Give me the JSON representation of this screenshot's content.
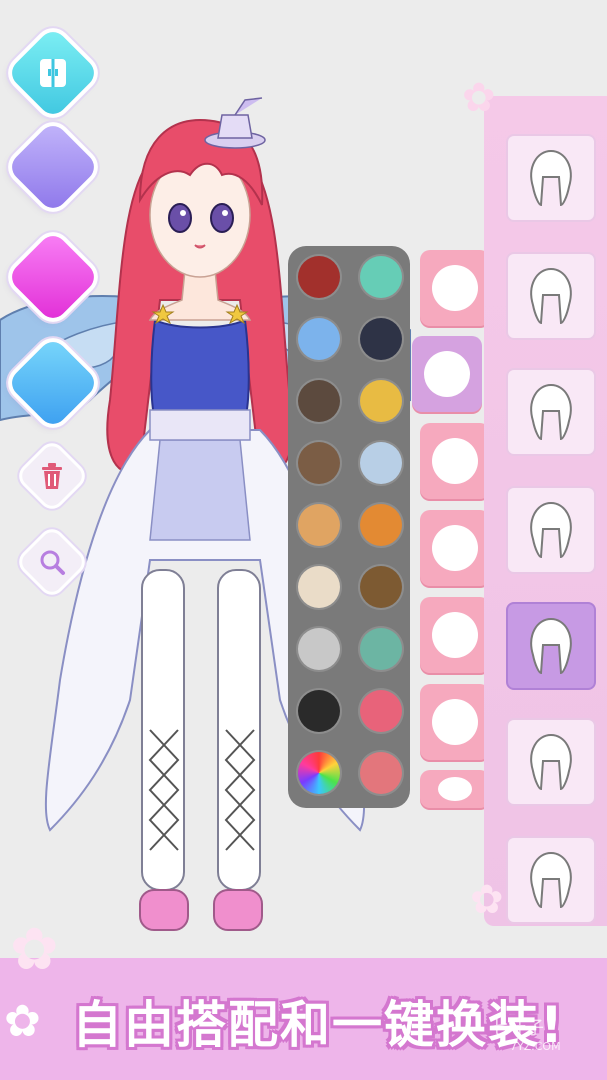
{
  "banner": {
    "title": "自由搭配和一键换装!",
    "watermark": "七叶子",
    "watermark_url": "7YZ.COM"
  },
  "tools": [
    {
      "icon": "wardrobe-icon",
      "color": "#4fd7e4"
    },
    {
      "icon": "background-color-icon",
      "color": "#a38cf0"
    },
    {
      "icon": "skin-color-icon",
      "color": "#f24ae6"
    },
    {
      "icon": "hair-color-icon",
      "color": "#4cb8f5"
    },
    {
      "icon": "trash-icon",
      "color": "#e05a78"
    },
    {
      "icon": "zoom-icon",
      "color": "#b77ee0"
    }
  ],
  "palette": {
    "colors": [
      "#a2302c",
      "#66cdb6",
      "#7cb3ec",
      "#2e3346",
      "#5c4a3e",
      "#e8bb43",
      "#7b5d45",
      "#b8cfe6",
      "#e0a462",
      "#e38a33",
      "#eadcc8",
      "#7d5a32",
      "#c8c8c8",
      "#6cb5a3",
      "#2a2a2a",
      "#e8637a",
      "rainbow",
      "#e3767c"
    ]
  },
  "categories": [
    {
      "icon": "hair-color-split-icon",
      "selected": false
    },
    {
      "icon": "hairstyle-icon",
      "selected": true
    },
    {
      "icon": "back-hair-icon",
      "selected": false
    },
    {
      "icon": "face-icon",
      "selected": false
    },
    {
      "icon": "eyes-closed-face-icon",
      "selected": false
    },
    {
      "icon": "smile-face-icon",
      "selected": false
    },
    {
      "icon": "cat-ears-icon",
      "selected": false
    }
  ],
  "hair_options": [
    {
      "name": "short-messy-hair",
      "selected": false
    },
    {
      "name": "bun-updo-hair",
      "selected": false
    },
    {
      "name": "braided-hime-hair",
      "selected": false
    },
    {
      "name": "wavy-long-hair",
      "selected": false
    },
    {
      "name": "side-swept-hair",
      "selected": true
    },
    {
      "name": "short-bob-hair",
      "selected": false
    },
    {
      "name": "curly-medium-hair",
      "selected": false
    }
  ]
}
